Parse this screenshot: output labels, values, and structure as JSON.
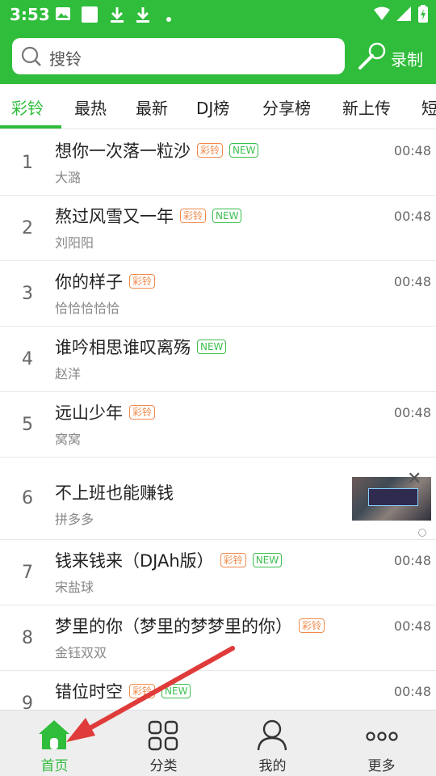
{
  "status_bar": {
    "time": "3:53"
  },
  "search": {
    "placeholder": "搜铃"
  },
  "header": {
    "record_label": "录制"
  },
  "tabs": [
    {
      "label": "彩铃",
      "active": true
    },
    {
      "label": "最热"
    },
    {
      "label": "最新"
    },
    {
      "label": "DJ榜"
    },
    {
      "label": "分享榜"
    },
    {
      "label": "新上传"
    },
    {
      "label": "短"
    }
  ],
  "tag_labels": {
    "caling": "彩铃",
    "new": "NEW"
  },
  "songs": [
    {
      "rank": "1",
      "title": "想你一次落一粒沙",
      "artist": "大潞",
      "duration": "00:48",
      "caling": true,
      "new": true
    },
    {
      "rank": "2",
      "title": "熬过风雪又一年",
      "artist": "刘阳阳",
      "duration": "00:48",
      "caling": true,
      "new": true
    },
    {
      "rank": "3",
      "title": "你的样子",
      "artist": "恰恰恰恰恰",
      "duration": "00:48",
      "caling": true,
      "new": false
    },
    {
      "rank": "4",
      "title": "谁吟相思谁叹离殇",
      "artist": "赵洋",
      "duration": "00:48",
      "caling": false,
      "new": true
    },
    {
      "rank": "5",
      "title": "远山少年",
      "artist": "窝窝",
      "duration": "00:48",
      "caling": true,
      "new": false
    },
    {
      "rank": "6",
      "title": "不上班也能赚钱",
      "artist": "拼多多",
      "ad": true
    },
    {
      "rank": "7",
      "title": "钱来钱来（DJAh版）",
      "artist": "宋盐球",
      "duration": "00:48",
      "caling": true,
      "new": true
    },
    {
      "rank": "8",
      "title": "梦里的你（梦里的梦梦里的你）",
      "artist": "金钰双双",
      "duration": "00:48",
      "caling": true,
      "new": false
    },
    {
      "rank": "9",
      "title": "错位时空",
      "artist": "",
      "duration": "00:48",
      "caling": true,
      "new": true
    }
  ],
  "bottom_nav": [
    {
      "label": "首页",
      "icon": "home-icon",
      "active": true
    },
    {
      "label": "分类",
      "icon": "grid-icon"
    },
    {
      "label": "我的",
      "icon": "profile-icon"
    },
    {
      "label": "更多",
      "icon": "more-icon"
    }
  ],
  "colors": {
    "accent": "#2fbd3b",
    "tag_caling": "#f08a4b",
    "tag_new": "#3cbf4f",
    "arrow": "#e03b3b"
  }
}
